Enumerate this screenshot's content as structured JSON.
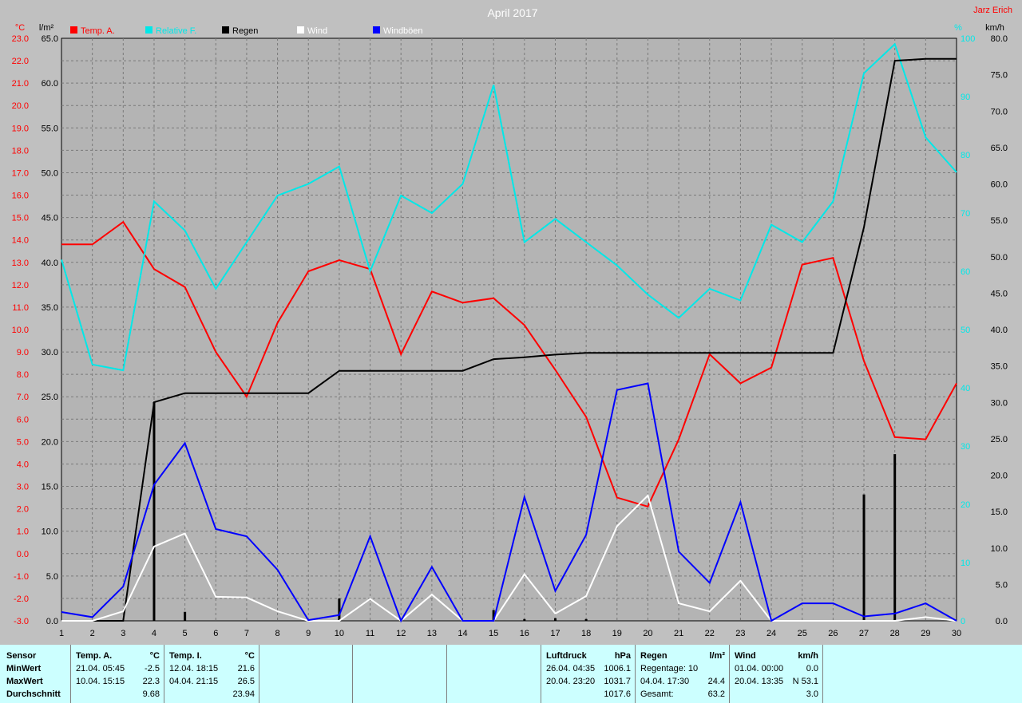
{
  "chart_data": {
    "type": "line",
    "title": "April 2017",
    "author": "Jarz Erich",
    "x": [
      1,
      2,
      3,
      4,
      5,
      6,
      7,
      8,
      9,
      10,
      11,
      12,
      13,
      14,
      15,
      16,
      17,
      18,
      19,
      20,
      21,
      22,
      23,
      24,
      25,
      26,
      27,
      28,
      29,
      30
    ],
    "x_ticks": [
      "1",
      "2",
      "3",
      "4",
      "5",
      "6",
      "7",
      "8",
      "9",
      "10",
      "11",
      "12",
      "13",
      "14",
      "15",
      "16",
      "17",
      "18",
      "19",
      "20",
      "21",
      "22",
      "23",
      "24",
      "25",
      "26",
      "27",
      "28",
      "29",
      "30"
    ],
    "grid": true,
    "legend_placement": "top",
    "axes": {
      "temp": {
        "unit": "°C",
        "min": -3,
        "max": 23,
        "ticks": [
          "-3.0",
          "-2.0",
          "-1.0",
          "0.0",
          "1.0",
          "2.0",
          "3.0",
          "4.0",
          "5.0",
          "6.0",
          "7.0",
          "8.0",
          "9.0",
          "10.0",
          "11.0",
          "12.0",
          "13.0",
          "14.0",
          "15.0",
          "16.0",
          "17.0",
          "18.0",
          "19.0",
          "20.0",
          "21.0",
          "22.0",
          "23.0"
        ],
        "color": "#ff0000"
      },
      "rain": {
        "unit": "l/m²",
        "min": 0,
        "max": 65,
        "ticks": [
          "0.0",
          "5.0",
          "10.0",
          "15.0",
          "20.0",
          "25.0",
          "30.0",
          "35.0",
          "40.0",
          "45.0",
          "50.0",
          "55.0",
          "60.0",
          "65.0"
        ],
        "color": "#000000"
      },
      "humidity": {
        "unit": "%",
        "min": 0,
        "max": 100,
        "ticks": [
          "0",
          "10",
          "20",
          "30",
          "40",
          "50",
          "60",
          "70",
          "80",
          "90",
          "100"
        ],
        "color": "#00e8e8"
      },
      "wind": {
        "unit": "km/h",
        "min": 0,
        "max": 80,
        "ticks": [
          "0.0",
          "5.0",
          "10.0",
          "15.0",
          "20.0",
          "25.0",
          "30.0",
          "35.0",
          "40.0",
          "45.0",
          "50.0",
          "55.0",
          "60.0",
          "65.0",
          "70.0",
          "75.0",
          "80.0"
        ],
        "color": "#000000"
      }
    },
    "series": [
      {
        "name": "Temp. A.",
        "color": "#ff0000",
        "axis": "temp",
        "values": [
          13.8,
          13.8,
          14.8,
          12.7,
          11.9,
          9.0,
          7.0,
          10.3,
          12.6,
          13.1,
          12.7,
          8.9,
          11.7,
          11.2,
          11.4,
          10.2,
          8.2,
          6.1,
          2.5,
          2.1,
          5.1,
          8.9,
          7.6,
          8.3,
          12.9,
          13.2,
          8.6,
          5.2,
          5.1,
          7.6
        ]
      },
      {
        "name": "Relative F.",
        "color": "#00e8e8",
        "axis": "humidity",
        "values": [
          62,
          44,
          43,
          72,
          67,
          57,
          65,
          73,
          75,
          78,
          60,
          73,
          70,
          75,
          92,
          65,
          69,
          65,
          61,
          56,
          52,
          57,
          55,
          68,
          65,
          72,
          94,
          99,
          83,
          77
        ]
      },
      {
        "name": "Regen",
        "color": "#000000",
        "axis": "rain",
        "values": [
          0,
          0,
          0,
          24.4,
          25.4,
          25.4,
          25.4,
          25.4,
          25.4,
          27.9,
          27.9,
          27.9,
          27.9,
          27.9,
          29.2,
          29.4,
          29.7,
          29.9,
          29.9,
          29.9,
          29.9,
          29.9,
          29.9,
          29.9,
          29.9,
          29.9,
          43.9,
          62.5,
          62.7,
          62.7
        ]
      },
      {
        "name": "Wind",
        "color": "#ffffff",
        "axis": "wind",
        "values": [
          0,
          0,
          1.3,
          10.2,
          12.0,
          3.3,
          3.2,
          1.3,
          0,
          0,
          3.0,
          0,
          3.6,
          0,
          0,
          6.4,
          1.0,
          3.4,
          13.0,
          17.2,
          2.4,
          1.3,
          5.5,
          0,
          0,
          0,
          0,
          0,
          0.5,
          0
        ]
      },
      {
        "name": "Windböen",
        "color": "#0000ff",
        "axis": "wind",
        "values": [
          1.2,
          0.5,
          4.7,
          18.7,
          24.4,
          12.6,
          11.6,
          7.0,
          0.1,
          0.8,
          11.6,
          0,
          7.4,
          0,
          0,
          17.0,
          4.1,
          11.8,
          31.7,
          32.6,
          9.5,
          5.2,
          16.3,
          0,
          2.4,
          2.4,
          0.6,
          1.0,
          2.4,
          0
        ]
      },
      {
        "name": "Tagesregen",
        "color": "#000000",
        "axis": "rain",
        "type": "bar",
        "values": [
          0,
          0,
          0,
          24.4,
          1.0,
          0,
          0,
          0,
          0,
          2.5,
          0,
          0,
          0,
          0,
          1.2,
          0.2,
          0.3,
          0.2,
          0,
          0,
          0,
          0,
          0,
          0,
          0,
          0,
          14.1,
          18.6,
          0,
          0
        ]
      }
    ]
  },
  "legend": [
    {
      "label": "Temp. A.",
      "color": "#ff0000"
    },
    {
      "label": "Relative F.",
      "color": "#00e8e8"
    },
    {
      "label": "Regen",
      "color": "#000000"
    },
    {
      "label": "Wind",
      "color": "#ffffff"
    },
    {
      "label": "Windböen",
      "color": "#0000ff"
    }
  ],
  "stats": {
    "labels": {
      "sensor": "Sensor",
      "min": "MinWert",
      "max": "MaxWert",
      "avg": "Durchschnitt"
    },
    "temp_a": {
      "title": "Temp. A.",
      "unit": "°C",
      "min_when": "21.04.  05:45",
      "min_val": "-2.5",
      "max_when": "10.04.  15:15",
      "max_val": "22.3",
      "avg": "9.68"
    },
    "temp_i": {
      "title": "Temp. I.",
      "unit": "°C",
      "min_when": "12.04.  18:15",
      "min_val": "21.6",
      "max_when": "04.04.  21:15",
      "max_val": "26.5",
      "avg": "23.94"
    },
    "pressure": {
      "title": "Luftdruck",
      "unit": "hPa",
      "min_when": "26.04.  04:35",
      "min_val": "1006.1",
      "max_when": "20.04.  23:20",
      "max_val": "1031.7",
      "avg": "1017.6"
    },
    "rain": {
      "title": "Regen",
      "unit": "l/m²",
      "row1": "Regentage: 10",
      "max_when": "04.04.  17:30",
      "max_val": "24.4",
      "total_label": "Gesamt:",
      "total": "63.2"
    },
    "wind": {
      "title": "Wind",
      "unit": "km/h",
      "min_when": "01.04.  00:00",
      "min_val": "0.0",
      "max_when": "20.04.  13:35",
      "max_val": "N 53.1",
      "avg": "3.0"
    }
  }
}
